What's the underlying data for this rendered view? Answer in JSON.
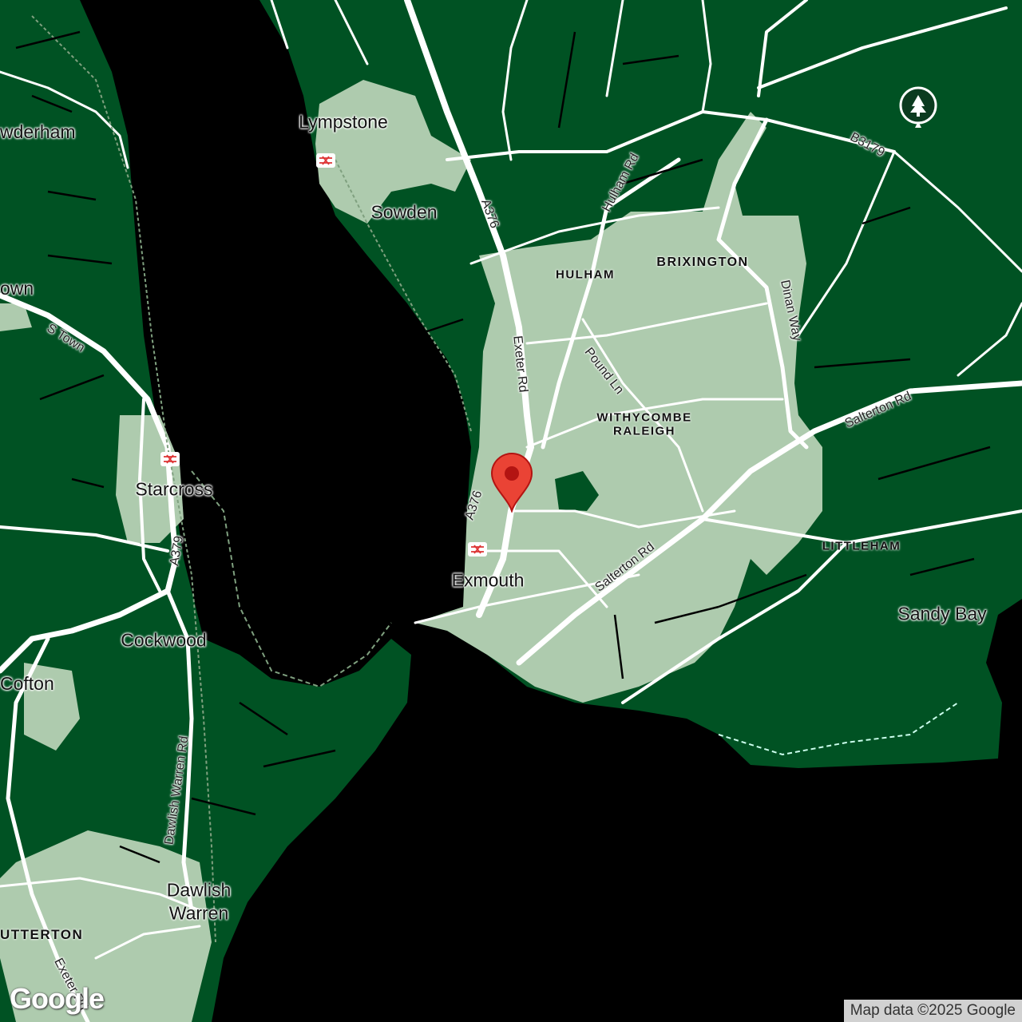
{
  "map": {
    "places": {
      "lympstone": "Lympstone",
      "powderham": "wderham",
      "sowden": "Sowden",
      "brixington": "BRIXINGTON",
      "hulham": "HULHAM",
      "town_left": "own",
      "s_town": "S Town",
      "withycombe_1": "WITHYCOMBE",
      "withycombe_2": "RALEIGH",
      "starcross": "Starcross",
      "exmouth": "Exmouth",
      "littleham": "LITTLEHAM",
      "sandy_bay": "Sandy Bay",
      "cockwood": "Cockwood",
      "cofton": "Cofton",
      "dawlish_warren_1": "Dawlish",
      "dawlish_warren_2": "Warren",
      "cutterton": "UTTERTON"
    },
    "roads": {
      "a376_north": "A376",
      "a376_south": "A376",
      "hulham_rd": "Hulham Rd",
      "b3179": "B3179",
      "dinan_way": "Dinan Way",
      "exeter_rd": "Exeter Rd",
      "pound_ln": "Pound Ln",
      "salterton_rd_east": "Salterton Rd",
      "salterton_rd_south": "Salterton Rd",
      "a379": "A379",
      "dawlish_warren_rd": "Dawlish Warren Rd",
      "exeter_rd_sw": "Exeter Rd"
    },
    "icons": {
      "marker": "map-pin-icon",
      "rail": "train-station-icon",
      "park": "tree-icon"
    },
    "colors": {
      "land": "#005223",
      "urban": "#aecbae",
      "water": "#000000",
      "road": "#ffffff",
      "marker": "#ea4335"
    },
    "branding": {
      "logo": "Google",
      "attribution": "Map data ©2025 Google"
    }
  }
}
